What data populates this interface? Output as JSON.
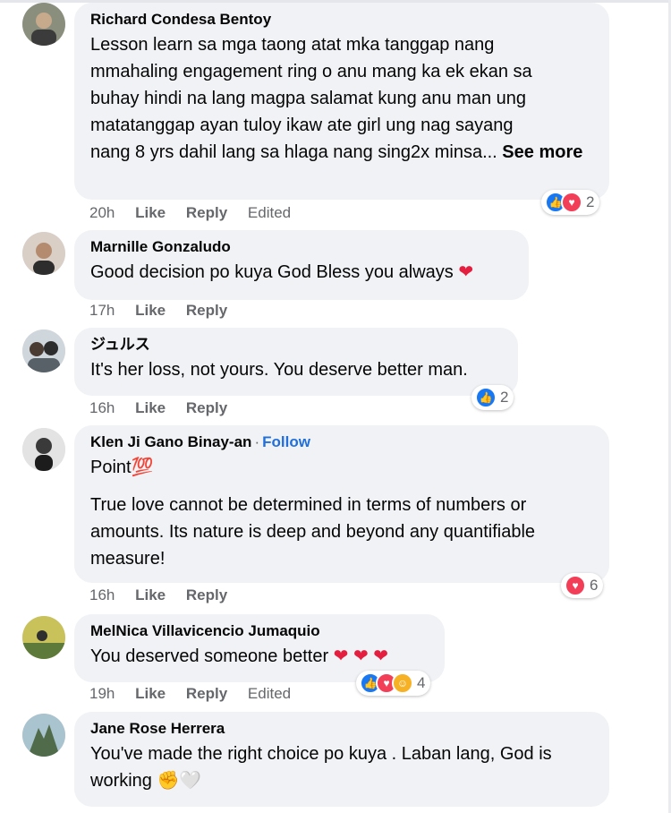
{
  "comments": [
    {
      "author": "Richard Condesa Bentoy",
      "text_lines": [
        "Lesson learn sa mga taong atat mka tanggap nang",
        "mmahaling engagement ring o anu mang ka ek ekan sa",
        "buhay hindi na lang magpa salamat kung anu man ung",
        "matatanggap ayan tuloy ikaw ate girl ung nag sayang",
        "nang 8 yrs dahil lang sa hlaga nang sing2x minsa... "
      ],
      "see_more": "See more",
      "time": "20h",
      "like": "Like",
      "reply": "Reply",
      "edited": "Edited",
      "reaction_count": "2",
      "reactions": [
        "like-icon",
        "love-icon"
      ]
    },
    {
      "author": "Marnille Gonzaludo",
      "text": "Good decision po kuya God Bless you always ",
      "emoji": "❤",
      "time": "17h",
      "like": "Like",
      "reply": "Reply"
    },
    {
      "author": "ジュルス",
      "text": "It's her loss, not yours. You deserve better man.",
      "time": "16h",
      "like": "Like",
      "reply": "Reply",
      "reaction_count": "2",
      "reactions": [
        "like-icon"
      ]
    },
    {
      "author": "Klen Ji Gano Binay-an",
      "separator": "·",
      "follow": "Follow",
      "line1": "Point💯",
      "paragraph": "True love cannot be determined in terms of numbers or amounts. Its nature is deep and beyond any quantifiable measure!",
      "time": "16h",
      "like": "Like",
      "reply": "Reply",
      "reaction_count": "6",
      "reactions": [
        "love-icon"
      ]
    },
    {
      "author": "MelNica Villavicencio Jumaquio",
      "text": "You deserved someone better ",
      "emoji": "❤ ❤ ❤",
      "time": "19h",
      "like": "Like",
      "reply": "Reply",
      "edited": "Edited",
      "reaction_count": "4",
      "reactions": [
        "like-icon",
        "love-icon",
        "care-icon"
      ]
    },
    {
      "author": "Jane Rose Herrera",
      "text": "You've made the right choice po kuya . Laban lang, God is working ",
      "emoji": "✊🤍",
      "time": "",
      "like": "",
      "reply": ""
    }
  ],
  "colors": {
    "bubble": "#f0f2f5",
    "like_blue": "#1877f2",
    "love_red": "#f33e58",
    "follow_blue": "#216fdb",
    "meta_gray": "#65676b"
  }
}
